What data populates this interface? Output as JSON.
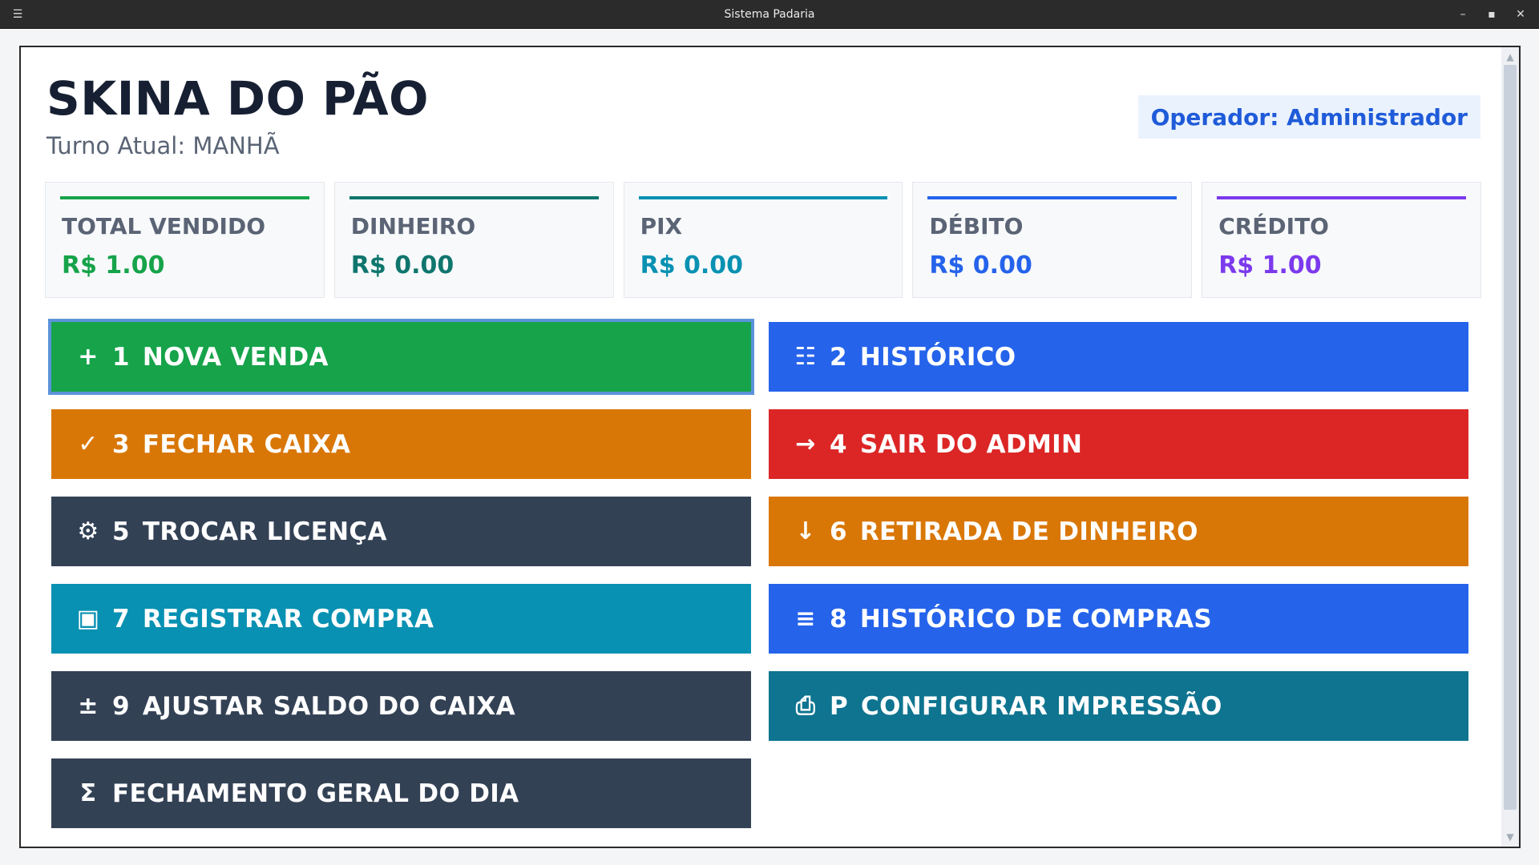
{
  "window": {
    "title": "Sistema Padaria",
    "menu_icon": "hamburger-icon",
    "controls": [
      "minimize-icon",
      "maximize-icon",
      "close-icon"
    ]
  },
  "header": {
    "shop_name": "SKINA DO PÃO",
    "shift": "Turno Atual: MANHÃ",
    "operator": "Operador: Administrador"
  },
  "summary": [
    {
      "label": "TOTAL VENDIDO",
      "value": "R$ 1.00",
      "color": "#16a34a"
    },
    {
      "label": "DINHEIRO",
      "value": "R$ 0.00",
      "color": "#0f766e"
    },
    {
      "label": "PIX",
      "value": "R$ 0.00",
      "color": "#0891b2"
    },
    {
      "label": "DÉBITO",
      "value": "R$ 0.00",
      "color": "#2563eb"
    },
    {
      "label": "CRÉDITO",
      "value": "R$ 1.00",
      "color": "#7c3aed"
    }
  ],
  "actions": [
    {
      "icon": "+",
      "icon_name": "plus-icon",
      "key": "1",
      "label": "NOVA VENDA",
      "color": "#16a34a"
    },
    {
      "icon": "☷",
      "icon_name": "list-icon",
      "key": "2",
      "label": "HISTÓRICO",
      "color": "#2563eb"
    },
    {
      "icon": "✓",
      "icon_name": "check-icon",
      "key": "3",
      "label": "FECHAR CAIXA",
      "color": "#d97706"
    },
    {
      "icon": "→",
      "icon_name": "arrow-right-icon",
      "key": "4",
      "label": "SAIR DO ADMIN",
      "color": "#dc2626"
    },
    {
      "icon": "⚙",
      "icon_name": "gear-icon",
      "key": "5",
      "label": "TROCAR LICENÇA",
      "color": "#334155"
    },
    {
      "icon": "↓",
      "icon_name": "arrow-down-icon",
      "key": "6",
      "label": "RETIRADA DE DINHEIRO",
      "color": "#d97706"
    },
    {
      "icon": "▣",
      "icon_name": "box-icon",
      "key": "7",
      "label": "REGISTRAR COMPRA",
      "color": "#0891b2"
    },
    {
      "icon": "≡",
      "icon_name": "menu-lines-icon",
      "key": "8",
      "label": "HISTÓRICO DE COMPRAS",
      "color": "#2563eb"
    },
    {
      "icon": "±",
      "icon_name": "plus-minus-icon",
      "key": "9",
      "label": "AJUSTAR SALDO DO CAIXA",
      "color": "#334155"
    },
    {
      "icon": "⎙",
      "icon_name": "printer-icon",
      "key": "P",
      "label": "CONFIGURAR IMPRESSÃO",
      "color": "#0e7490"
    },
    {
      "icon": "Σ",
      "icon_name": "sigma-icon",
      "key": "",
      "label": "FECHAMENTO GERAL DO DIA",
      "color": "#334155"
    }
  ]
}
